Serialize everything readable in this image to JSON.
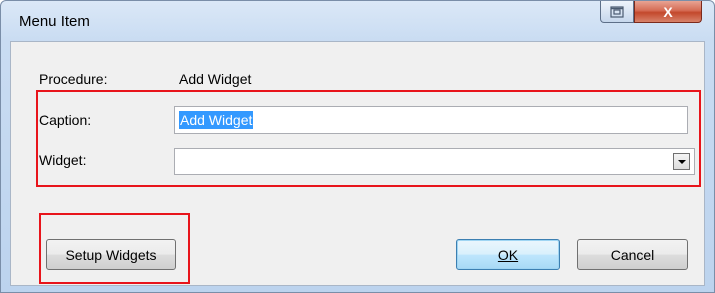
{
  "window": {
    "title": "Menu Item",
    "restore_icon": "restore-icon",
    "close_icon": "close-icon",
    "close_glyph": "X"
  },
  "form": {
    "procedure_label": "Procedure:",
    "procedure_value": "Add Widget",
    "caption_label": "Caption:",
    "caption_value": "Add Widget",
    "widget_label": "Widget:",
    "widget_value": ""
  },
  "buttons": {
    "setup_widgets": "Setup Widgets",
    "ok": "OK",
    "cancel": "Cancel"
  },
  "colors": {
    "highlight_box": "#e8141b",
    "selection": "#3399ff"
  }
}
